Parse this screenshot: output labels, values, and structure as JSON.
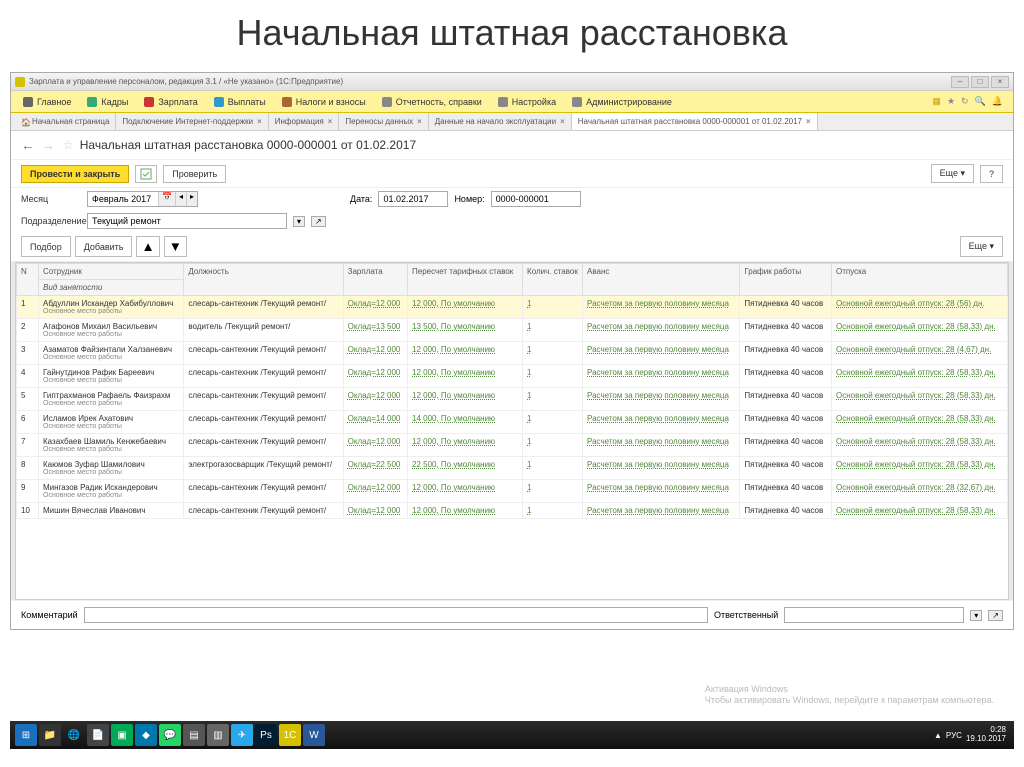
{
  "slide": {
    "title": "Начальная штатная расстановка"
  },
  "window": {
    "title": "Зарплата и управление персоналом, редакция 3.1 / «Не указано» (1С:Предприятие)"
  },
  "menubar": {
    "items": [
      "Главное",
      "Кадры",
      "Зарплата",
      "Выплаты",
      "Налоги и взносы",
      "Отчетность, справки",
      "Настройка",
      "Администрирование"
    ]
  },
  "tabs": [
    {
      "label": "Начальная страница",
      "closable": false,
      "home": true
    },
    {
      "label": "Подключение Интернет-поддержки",
      "closable": true
    },
    {
      "label": "Информация",
      "closable": true
    },
    {
      "label": "Переносы данных",
      "closable": true
    },
    {
      "label": "Данные на начало эксплуатации",
      "closable": true
    },
    {
      "label": "Начальная штатная расстановка 0000-000001 от 01.02.2017",
      "closable": true,
      "active": true
    }
  ],
  "doc": {
    "title": "Начальная штатная расстановка 0000-000001 от 01.02.2017"
  },
  "toolbar": {
    "save_close": "Провести и закрыть",
    "check": "Проверить",
    "more": "Еще",
    "help": "?"
  },
  "form": {
    "month_label": "Месяц",
    "month_value": "Февраль 2017",
    "date_label": "Дата:",
    "date_value": "01.02.2017",
    "number_label": "Номер:",
    "number_value": "0000-000001",
    "subunit_label": "Подразделение",
    "subunit_value": "Текущий ремонт"
  },
  "actions": {
    "select": "Подбор",
    "add": "Добавить",
    "more": "Еще"
  },
  "columns": {
    "n": "N",
    "employee": "Сотрудник",
    "employment": "Вид занятости",
    "position": "Должность",
    "salary": "Зарплата",
    "recalc": "Пересчет тарифных ставок",
    "units": "Колич. ставок",
    "advance": "Аванс",
    "schedule": "График работы",
    "vacation": "Отпуска"
  },
  "rows": [
    {
      "n": "1",
      "emp": "Абдуллин Искандер Хабибуллович",
      "empl": "Основное место работы",
      "pos": "слесарь-сантехник /Текущий ремонт/",
      "sal": "Оклад=12 000",
      "rec": "12 000, По умолчанию",
      "units": "1",
      "adv": "Расчетом за первую половину месяца",
      "sch": "Пятидневка 40 часов",
      "vac": "Основной ежегодный отпуск: 28 (56) дн."
    },
    {
      "n": "2",
      "emp": "Агафонов Михаил Васильевич",
      "empl": "Основное место работы",
      "pos": "водитель /Текущий ремонт/",
      "sal": "Оклад=13 500",
      "rec": "13 500, По умолчанию",
      "units": "1",
      "adv": "Расчетом за первую половину месяца",
      "sch": "Пятидневка 40 часов",
      "vac": "Основной ежегодный отпуск: 28 (58,33) дн."
    },
    {
      "n": "3",
      "emp": "Азаматов Файзинтали Халзаневич",
      "empl": "Основное место работы",
      "pos": "слесарь-сантехник /Текущий ремонт/",
      "sal": "Оклад=12 000",
      "rec": "12 000, По умолчанию",
      "units": "1",
      "adv": "Расчетом за первую половину месяца",
      "sch": "Пятидневка 40 часов",
      "vac": "Основной ежегодный отпуск: 28 (4,67) дн."
    },
    {
      "n": "4",
      "emp": "Гайнутдинов Рафик Бареевич",
      "empl": "Основное место работы",
      "pos": "слесарь-сантехник /Текущий ремонт/",
      "sal": "Оклад=12 000",
      "rec": "12 000, По умолчанию",
      "units": "1",
      "adv": "Расчетом за первую половину месяца",
      "sch": "Пятидневка 40 часов",
      "vac": "Основной ежегодный отпуск: 28 (58,33) дн."
    },
    {
      "n": "5",
      "emp": "Гиптрахманов Рафаель Фаизрахм",
      "empl": "Основное место работы",
      "pos": "слесарь-сантехник /Текущий ремонт/",
      "sal": "Оклад=12 000",
      "rec": "12 000, По умолчанию",
      "units": "1",
      "adv": "Расчетом за первую половину месяца",
      "sch": "Пятидневка 40 часов",
      "vac": "Основной ежегодный отпуск: 28 (58,33) дн."
    },
    {
      "n": "6",
      "emp": "Исламов Ирек Ахатович",
      "empl": "Основное место работы",
      "pos": "слесарь-сантехник /Текущий ремонт/",
      "sal": "Оклад=14 000",
      "rec": "14 000, По умолчанию",
      "units": "1",
      "adv": "Расчетом за первую половину месяца",
      "sch": "Пятидневка 40 часов",
      "vac": "Основной ежегодный отпуск: 28 (58,33) дн."
    },
    {
      "n": "7",
      "emp": "Казахбаев Шамиль Кенжебаевич",
      "empl": "Основное место работы",
      "pos": "слесарь-сантехник /Текущий ремонт/",
      "sal": "Оклад=12 000",
      "rec": "12 000, По умолчанию",
      "units": "1",
      "adv": "Расчетом за первую половину месяца",
      "sch": "Пятидневка 40 часов",
      "vac": "Основной ежегодный отпуск: 28 (58,33) дн."
    },
    {
      "n": "8",
      "emp": "Каюмов Зуфар Шамилович",
      "empl": "Основное место работы",
      "pos": "электрогазосварщик /Текущий ремонт/",
      "sal": "Оклад=22 500",
      "rec": "22 500, По умолчанию",
      "units": "1",
      "adv": "Расчетом за первую половину месяца",
      "sch": "Пятидневка 40 часов",
      "vac": "Основной ежегодный отпуск: 28 (58,33) дн."
    },
    {
      "n": "9",
      "emp": "Мингазов Радик Искандерович",
      "empl": "Основное место работы",
      "pos": "слесарь-сантехник /Текущий ремонт/",
      "sal": "Оклад=12 000",
      "rec": "12 000, По умолчанию",
      "units": "1",
      "adv": "Расчетом за первую половину месяца",
      "sch": "Пятидневка 40 часов",
      "vac": "Основной ежегодный отпуск: 28 (32,67) дн."
    },
    {
      "n": "10",
      "emp": "Мишин Вячеслав Иванович",
      "empl": "",
      "pos": "слесарь-сантехник /Текущий ремонт/",
      "sal": "Оклад=12 000",
      "rec": "12 000, По умолчанию",
      "units": "1",
      "adv": "Расчетом за первую половину месяца",
      "sch": "Пятидневка 40 часов",
      "vac": "Основной ежегодный отпуск: 28 (58,33) дн."
    }
  ],
  "footer": {
    "comment_label": "Комментарий",
    "responsible_label": "Ответственный"
  },
  "watermark": {
    "line1": "Активация Windows",
    "line2": "Чтобы активировать Windows, перейдите к параметрам компьютера."
  },
  "tray": {
    "lang": "РУС",
    "time": "0:28",
    "date": "19.10.2017"
  }
}
